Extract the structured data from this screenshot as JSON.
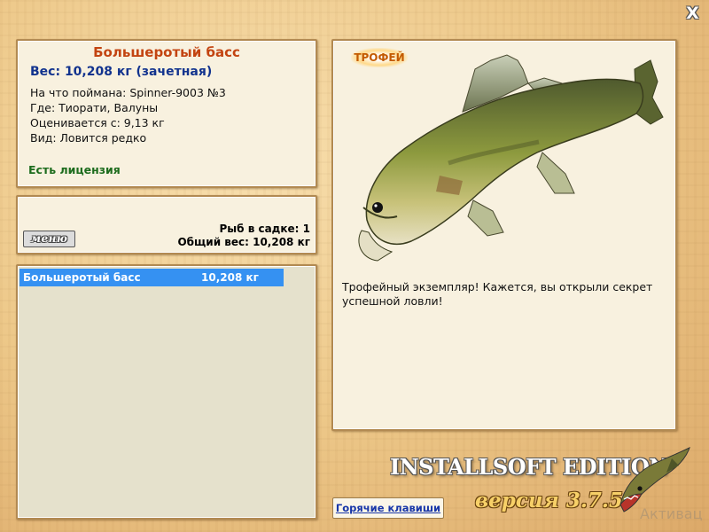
{
  "close_label": "X",
  "catch": {
    "title": "Большеротый басс",
    "weight_line": "Вес: 10,208 кг (зачетная)",
    "bait": "На что поймана: Spinner-9003 №3",
    "location": "Где: Тиорати, Валуны",
    "value": "Оценивается с: 9,13 кг",
    "rarity": "Вид: Ловится редко",
    "license": "Есть лицензия"
  },
  "keepnet": {
    "menu_label": "меню",
    "fish_count": "Рыб в садке: 1",
    "total_weight": "Общий вес: 10,208 кг"
  },
  "fish_list": [
    {
      "name": "Большеротый басс",
      "weight": "10,208 кг"
    }
  ],
  "trophy": {
    "badge": "ТРОФЕЙ",
    "caption": "Трофейный экземпляр! Кажется, вы открыли секрет успешной ловли!"
  },
  "branding": {
    "edition": "INSTALLSOFT EDITION",
    "version": "версия 3.7.5",
    "watermark": "Активац"
  },
  "hotkeys_label": "Горячие клавиши",
  "colors": {
    "title": "#c34411",
    "weight": "#12338e",
    "license": "#1d6c1d",
    "selection": "#3591f2"
  }
}
